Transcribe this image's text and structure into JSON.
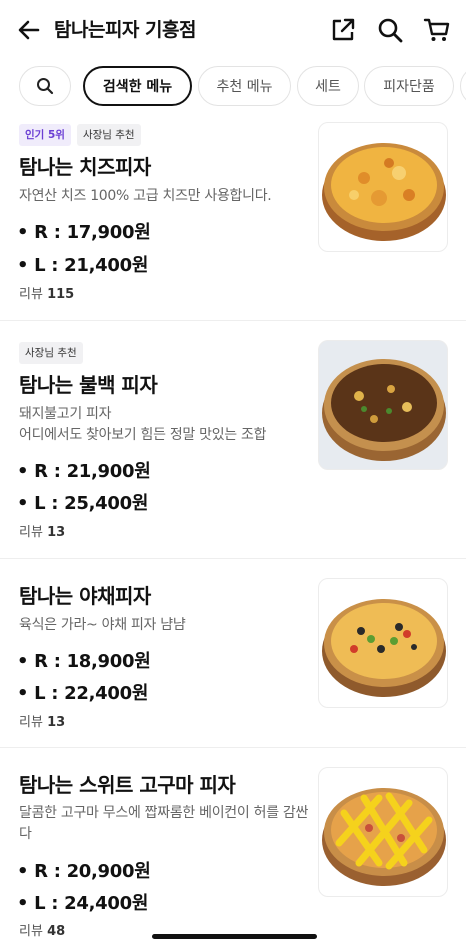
{
  "header": {
    "title": "탐나는피자 기흥점",
    "icons": [
      "back-arrow-icon",
      "share-icon",
      "search-icon",
      "cart-icon"
    ]
  },
  "chips": [
    "검색한 메뉴",
    "추천 메뉴",
    "세트",
    "피자단품"
  ],
  "active_chip": "검색한 메뉴",
  "items": [
    {
      "badges": [
        "인기 5위",
        "사장님 추천"
      ],
      "name": "탐나는 치즈피자",
      "desc": "자연산 치즈 100%  고급 치즈만 사용합니다.",
      "price_r": "• R : 17,900원",
      "price_l": "• L : 21,400원",
      "review_label": "리뷰",
      "review_count": "115",
      "image": "cheese-pizza-image"
    },
    {
      "badges": [
        "사장님 추천"
      ],
      "name": "탐나는 불백 피자",
      "desc": "돼지불고기 피자\n어디에서도 찾아보기 힘든 정말 맛있는 조합",
      "price_r": "• R : 21,900원",
      "price_l": "• L : 25,400원",
      "review_label": "리뷰",
      "review_count": "13",
      "image": "bulbaek-pizza-image"
    },
    {
      "badges": [],
      "name": "탐나는 야채피자",
      "desc": "육식은 가라~ 야채 피자 냠냠",
      "price_r": "• R : 18,900원",
      "price_l": "• L : 22,400원",
      "review_label": "리뷰",
      "review_count": "13",
      "image": "veggie-pizza-image"
    },
    {
      "badges": [],
      "name": "탐나는 스위트 고구마 피자",
      "desc": "달콤한 고구마 무스에 짭짜롬한 베이컨이 허를 감싼다",
      "price_r": "• R : 20,900원",
      "price_l": "• L : 24,400원",
      "review_label": "리뷰",
      "review_count": "48",
      "image": "sweet-potato-pizza-image"
    }
  ],
  "colors": {
    "accent_badge": "#6b3fd4",
    "text": "#111111",
    "muted": "#666666"
  }
}
